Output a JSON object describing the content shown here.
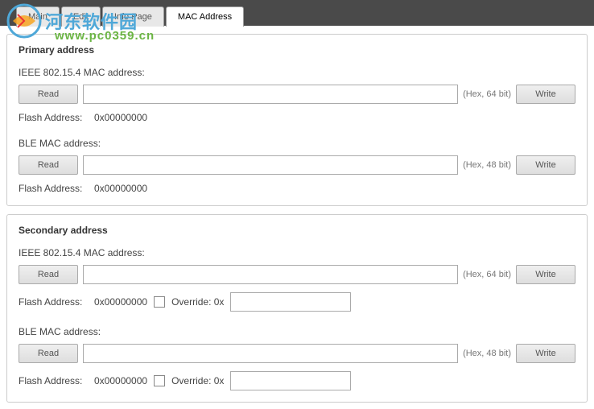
{
  "watermark": {
    "brand": "河东软件园",
    "url": "www.pc0359.cn"
  },
  "tabs": {
    "main": "Main",
    "edit": "Edit",
    "info": "Info Page",
    "mac": "MAC Address"
  },
  "primary": {
    "title": "Primary address",
    "ieee_label": "IEEE 802.15.4 MAC address:",
    "ieee_value": "",
    "ieee_hint": "(Hex, 64 bit)",
    "ieee_flash_label": "Flash Address:",
    "ieee_flash_value": "0x00000000",
    "ble_label": "BLE MAC address:",
    "ble_value": "",
    "ble_hint": "(Hex, 48 bit)",
    "ble_flash_label": "Flash Address:",
    "ble_flash_value": "0x00000000"
  },
  "secondary": {
    "title": "Secondary address",
    "ieee_label": "IEEE 802.15.4 MAC address:",
    "ieee_value": "",
    "ieee_hint": "(Hex, 64 bit)",
    "ieee_flash_label": "Flash Address:",
    "ieee_flash_value": "0x00000000",
    "ieee_override_label": "Override: 0x",
    "ieee_override_value": "",
    "ble_label": "BLE MAC address:",
    "ble_value": "",
    "ble_hint": "(Hex, 48 bit)",
    "ble_flash_label": "Flash Address:",
    "ble_flash_value": "0x00000000",
    "ble_override_label": "Override: 0x",
    "ble_override_value": ""
  },
  "buttons": {
    "read": "Read",
    "write": "Write"
  }
}
